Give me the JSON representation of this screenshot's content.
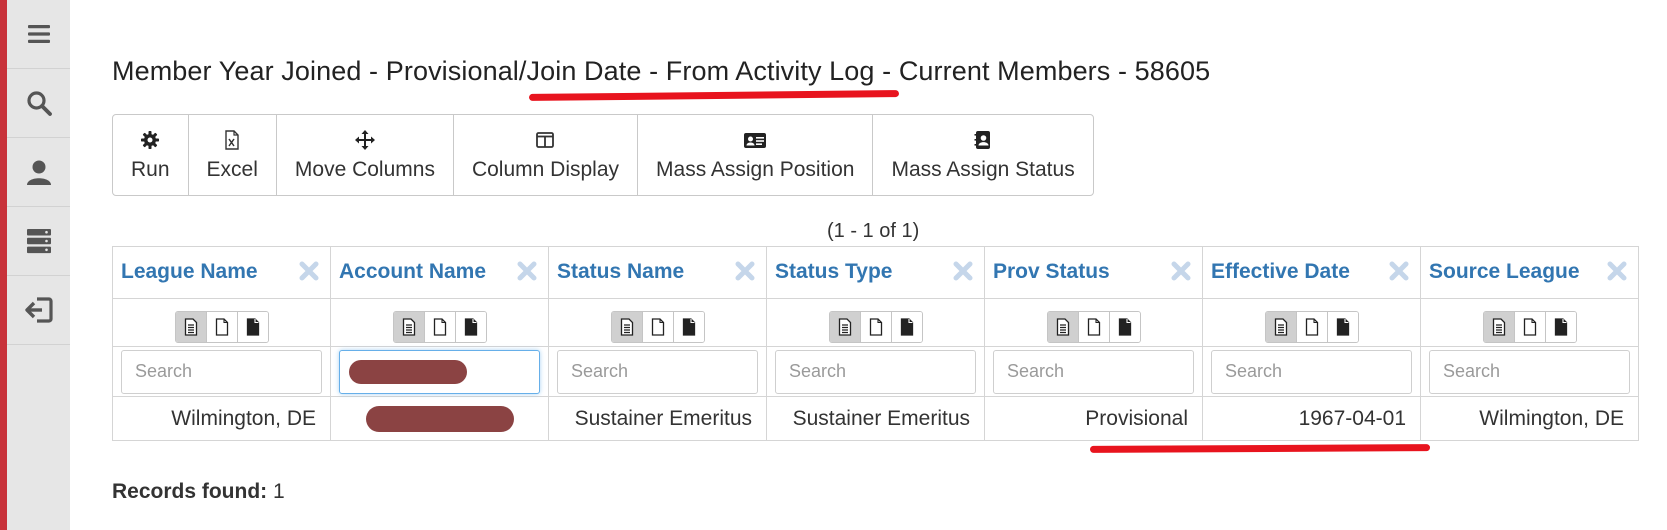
{
  "sidebar": {
    "items": [
      {
        "icon": "menu-icon"
      },
      {
        "icon": "search-icon"
      },
      {
        "icon": "user-icon"
      },
      {
        "icon": "server-icon"
      },
      {
        "icon": "sign-out-icon"
      }
    ],
    "accent_color": "#c8323a"
  },
  "page": {
    "title": "Member Year Joined - Provisional/Join Date - From Activity Log - Current Members - 58605"
  },
  "toolbar": {
    "buttons": [
      {
        "label": "Run",
        "icon": "gear-icon"
      },
      {
        "label": "Excel",
        "icon": "excel-file-icon"
      },
      {
        "label": "Move Columns",
        "icon": "move-arrows-icon"
      },
      {
        "label": "Column Display",
        "icon": "columns-icon"
      },
      {
        "label": "Mass Assign Position",
        "icon": "id-card-icon"
      },
      {
        "label": "Mass Assign Status",
        "icon": "contact-book-icon"
      }
    ]
  },
  "grid": {
    "pager": "(1 - 1 of 1)",
    "search_placeholder": "Search",
    "header_color": "#3276b1",
    "columns": [
      {
        "label": "League Name"
      },
      {
        "label": "Account Name"
      },
      {
        "label": "Status Name"
      },
      {
        "label": "Status Type"
      },
      {
        "label": "Prov Status"
      },
      {
        "label": "Effective Date"
      },
      {
        "label": "Source League"
      }
    ],
    "rows": [
      {
        "league_name": "Wilmington, DE",
        "account_name": "",
        "status_name": "Sustainer Emeritus",
        "status_type": "Sustainer Emeritus",
        "prov_status": "Provisional",
        "effective_date": "1967-04-01",
        "source_league": "Wilmington, DE"
      }
    ]
  },
  "footer": {
    "records_label": "Records found:",
    "records_count": "1"
  },
  "annotation_color": "#e8141e"
}
